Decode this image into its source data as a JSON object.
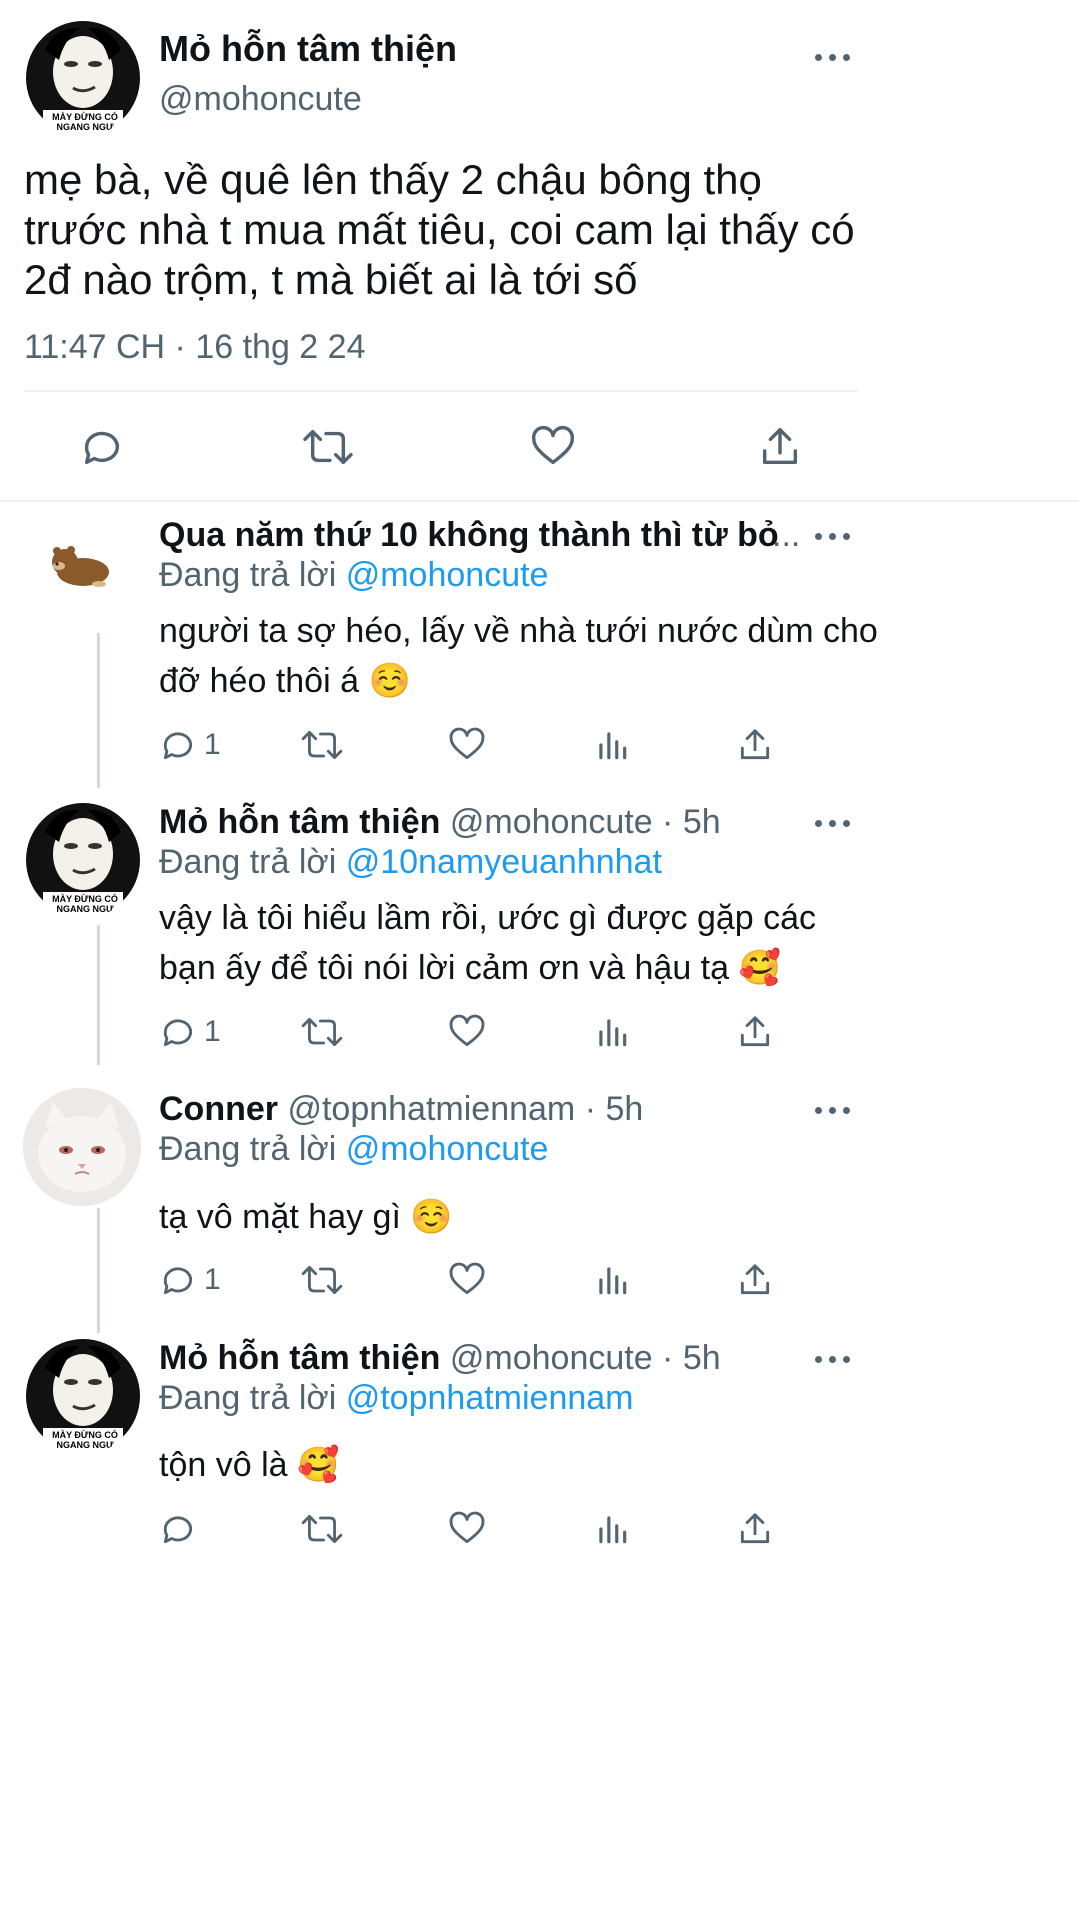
{
  "main": {
    "name": "Mỏ hỗn tâm thiện",
    "handle": "@mohoncute",
    "text_lines": [
      "mẹ bà, về quê lên thấy 2 chậu bông thọ",
      "trước nhà t mua mất tiêu, coi cam lại thấy có",
      "2đ nào trộm, t mà biết ai là tới số"
    ],
    "timestamp": "11:47 CH · 16 thg 2 24",
    "avatar_caption_1": "MÀY ĐỪNG CÓ",
    "avatar_caption_2": "NGANG NGƯ"
  },
  "replies": [
    {
      "name": "Qua năm thứ 10 không thành thì từ bỏ",
      "ellipsis": "...",
      "meta": "",
      "replying_prefix": "Đang trả lời",
      "replying_to": "@mohoncute",
      "text_lines": [
        "người ta sợ héo, lấy về nhà tưới nước dùm cho",
        "đỡ héo thôi á ☺️"
      ],
      "reply_count": "1",
      "avatar": "bear-avatar"
    },
    {
      "name": "Mỏ hỗn tâm thiện",
      "meta": "@mohoncute · 5h",
      "replying_prefix": "Đang trả lời",
      "replying_to": "@10namyeuanhnhat",
      "text_lines": [
        "vậy là tôi hiểu lầm rồi, ước gì được gặp các",
        "bạn ấy để tôi nói lời cảm ơn và hậu tạ 🥰"
      ],
      "reply_count": "1",
      "avatar": "meme-face-avatar"
    },
    {
      "name": "Conner",
      "meta": "@topnhatmiennam · 5h",
      "replying_prefix": "Đang trả lời",
      "replying_to": "@mohoncute",
      "text_lines": [
        "tạ vô mặt hay gì ☺️"
      ],
      "reply_count": "1",
      "avatar": "cat-avatar"
    },
    {
      "name": "Mỏ hỗn tâm thiện",
      "meta": "@mohoncute · 5h",
      "replying_prefix": "Đang trả lời",
      "replying_to": "@topnhatmiennam",
      "text_lines": [
        "tộn vô là 🥰"
      ],
      "reply_count": "",
      "avatar": "meme-face-avatar"
    }
  ],
  "icons": {
    "reply": "reply-icon",
    "retweet": "retweet-icon",
    "like": "heart-icon",
    "share": "share-icon",
    "views": "views-icon",
    "more": "more-icon"
  },
  "colors": {
    "link": "#1d9bf0",
    "muted": "#536471",
    "text": "#0f1419",
    "divider": "#eff3f4"
  }
}
